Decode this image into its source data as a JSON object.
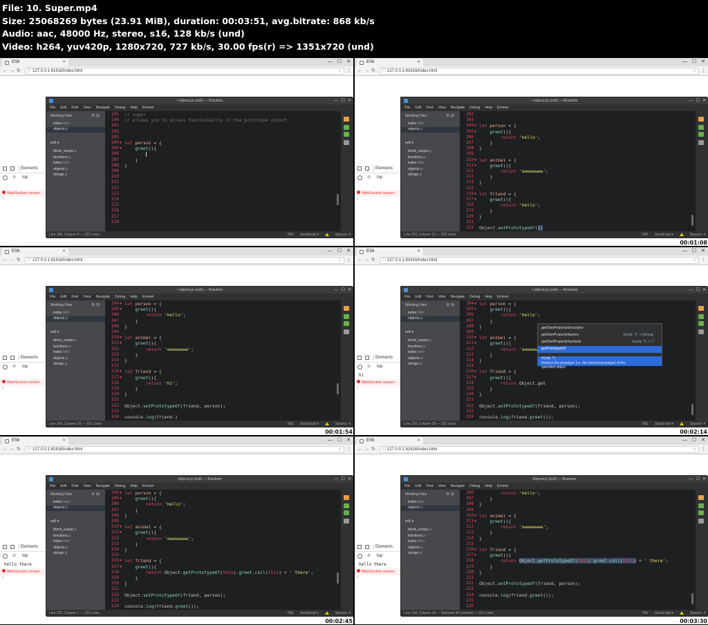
{
  "header": {
    "line1": "File: 10. Super.mp4",
    "line2": "Size: 25068269 bytes (23.91 MiB), duration: 00:03:51, avg.bitrate: 868 kb/s",
    "line3": "Audio: aac, 48000 Hz, stereo, s16, 128 kb/s (und)",
    "line4": "Video: h264, yuv420p, 1280x720, 727 kb/s, 30.00 fps(r) => 1351x720 (und)"
  },
  "browser": {
    "tab_title": "ES6",
    "url": "127.0.0.1:61616/index.html"
  },
  "devtools": {
    "elements_tab": "Elements",
    "context": "top",
    "error_text": "WebSocket connec"
  },
  "brackets": {
    "menu": [
      "File",
      "Edit",
      "Find",
      "View",
      "Navigate",
      "Debug",
      "Help",
      "Emmet"
    ],
    "working_files_label": "Working Files",
    "working_files": [
      {
        "name": "index",
        "ext": ".html"
      },
      {
        "name": "objects",
        "ext": ".js"
      }
    ],
    "project_label": "es6 ▾",
    "project_files": [
      {
        "name": "block_scope",
        "ext": ".js"
      },
      {
        "name": "functions",
        "ext": ".js"
      },
      {
        "name": "index",
        "ext": ".html"
      },
      {
        "name": "objects",
        "ext": ".js"
      },
      {
        "name": "strings",
        "ext": ".js"
      }
    ],
    "status_right": [
      "INS",
      "JavaScript ▾",
      "Spaces: 4"
    ]
  },
  "panels": [
    {
      "title": "• objects.js (es6) — Brackets",
      "timestamp": "",
      "status_left": "Line 206, Column 8 — 222 Lines",
      "log": "",
      "lines": [
        {
          "n": "195",
          "h": "<span class='cmt'>// super</span>"
        },
        {
          "n": "196",
          "h": "<span class='cmt'>// allows you to access functionality of the prototype object</span>"
        },
        {
          "n": "201",
          "h": ""
        },
        {
          "n": "202",
          "h": ""
        },
        {
          "n": "203",
          "h": ""
        },
        {
          "n": "204",
          "f": true,
          "h": "<span class='kw'>let</span> <span class='id'>person</span> = {"
        },
        {
          "n": "205",
          "f": true,
          "h": "    <span class='fn'>greet</span>(){"
        },
        {
          "n": "206",
          "h": "        <span class='cursor'></span>"
        },
        {
          "n": "207",
          "h": "    }"
        },
        {
          "n": "208",
          "h": "}"
        },
        {
          "n": "209",
          "h": ""
        },
        {
          "n": "210",
          "h": ""
        },
        {
          "n": "211",
          "h": ""
        },
        {
          "n": "212",
          "h": ""
        },
        {
          "n": "213",
          "h": ""
        },
        {
          "n": "214",
          "h": ""
        },
        {
          "n": "215",
          "h": ""
        },
        {
          "n": "216",
          "h": ""
        },
        {
          "n": "217",
          "h": ""
        },
        {
          "n": "218",
          "h": ""
        }
      ]
    },
    {
      "title": "• objects.js (es6) — Brackets",
      "timestamp": "00:01:08",
      "status_left": "Line 222, Column 23 — 228 Lines",
      "log": "",
      "lines": [
        {
          "n": "202",
          "h": ""
        },
        {
          "n": "203",
          "h": ""
        },
        {
          "n": "204",
          "f": true,
          "h": "<span class='kw'>let</span> <span class='id'>person</span> = {"
        },
        {
          "n": "205",
          "f": true,
          "h": "    <span class='fn'>greet</span>(){"
        },
        {
          "n": "206",
          "h": "        <span class='kw'>return</span> <span class='str'>'hello'</span>;"
        },
        {
          "n": "207",
          "h": "    }"
        },
        {
          "n": "208",
          "h": "}"
        },
        {
          "n": "209",
          "h": ""
        },
        {
          "n": "210",
          "f": true,
          "h": "<span class='kw'>let</span> <span class='id'>animal</span> = {"
        },
        {
          "n": "211",
          "f": true,
          "h": "    <span class='fn'>greet</span>(){"
        },
        {
          "n": "212",
          "h": "        <span class='kw'>return</span> <span class='str'>'owwwwwww'</span>;"
        },
        {
          "n": "213",
          "h": "    }"
        },
        {
          "n": "214",
          "h": "}"
        },
        {
          "n": "215",
          "h": ""
        },
        {
          "n": "216",
          "f": true,
          "h": "<span class='kw'>let</span> <span class='id'>friend</span> = {"
        },
        {
          "n": "217",
          "f": true,
          "h": "    <span class='fn'>greet</span>(){"
        },
        {
          "n": "218",
          "h": "        <span class='kw'>return</span> <span class='str'>'hello'</span>;"
        },
        {
          "n": "219",
          "h": "    }"
        },
        {
          "n": "220",
          "h": "}"
        },
        {
          "n": "221",
          "h": ""
        },
        {
          "n": "222",
          "h": "Object.<span class='fn'>setPrototypeOf</span>(<span class='hl-sel'>()</span>"
        }
      ]
    },
    {
      "title": "• objects.js (es6) — Brackets",
      "timestamp": "00:01:54",
      "status_left": "Line 224, Column 20 — 231 Lines",
      "log": "",
      "lines": [
        {
          "n": "204",
          "f": true,
          "h": "<span class='kw'>let</span> <span class='id'>person</span> = {"
        },
        {
          "n": "205",
          "f": true,
          "h": "    <span class='fn'>greet</span>(){"
        },
        {
          "n": "206",
          "h": "        <span class='kw'>return</span> <span class='str'>'hello'</span>;"
        },
        {
          "n": "207",
          "h": "    }"
        },
        {
          "n": "208",
          "h": "}"
        },
        {
          "n": "209",
          "h": ""
        },
        {
          "n": "210",
          "f": true,
          "h": "<span class='kw'>let</span> <span class='id'>animal</span> = {"
        },
        {
          "n": "211",
          "f": true,
          "h": "    <span class='fn'>greet</span>(){"
        },
        {
          "n": "212",
          "h": "        <span class='kw'>return</span> <span class='str'>'owwwwwww'</span>;"
        },
        {
          "n": "213",
          "h": "    }"
        },
        {
          "n": "214",
          "h": "}"
        },
        {
          "n": "215",
          "h": ""
        },
        {
          "n": "216",
          "f": true,
          "h": "<span class='kw'>let</span> <span class='id'>friend</span> = {"
        },
        {
          "n": "217",
          "f": true,
          "h": "    <span class='fn'>greet</span>(){"
        },
        {
          "n": "218",
          "h": "        <span class='kw'>return</span> <span class='str'>'hi'</span>;"
        },
        {
          "n": "219",
          "h": "    }"
        },
        {
          "n": "220",
          "h": "}"
        },
        {
          "n": "221",
          "h": ""
        },
        {
          "n": "222",
          "h": "Object.<span class='fn'>setPrototypeOf</span>(friend, person);"
        },
        {
          "n": "223",
          "h": ""
        },
        {
          "n": "224",
          "h": "console.<span class='fn'>log</span>(friend.)"
        }
      ]
    },
    {
      "title": "• objects.js (es6) — Brackets",
      "timestamp": "00:02:14",
      "status_left": "Line 218, Column 28 — 231 Lines",
      "log": "hi",
      "hint": {
        "items": [
          {
            "text": "getOwnPropertyDescriptor",
            "sig": ""
          },
          {
            "text": "getOwnPropertyNames",
            "sig": "fn(obj: ?) -> [string]"
          },
          {
            "text": "getOwnPropertySymbols",
            "sig": "fn(obj: ?) -> ?"
          },
          {
            "text": "getPrototypeOf",
            "sig": ""
          }
        ],
        "desc1": "fn(obj: ?)",
        "desc2": "Returns the prototype (i.e. the internal prototype) of the",
        "desc3": "specified object."
      },
      "lines": [
        {
          "n": "204",
          "f": true,
          "h": "<span class='kw'>let</span> <span class='id'>person</span> = {"
        },
        {
          "n": "205",
          "f": true,
          "h": "    <span class='fn'>greet</span>(){"
        },
        {
          "n": "206",
          "h": "        <span class='kw'>return</span> <span class='str'>'hello'</span>;"
        },
        {
          "n": "207",
          "h": "    }"
        },
        {
          "n": "208",
          "h": "}"
        },
        {
          "n": "209",
          "h": ""
        },
        {
          "n": "210",
          "f": true,
          "h": "<span class='kw'>let</span> <span class='id'>animal</span> = {"
        },
        {
          "n": "211",
          "f": true,
          "h": "    <span class='fn'>greet</span>(){"
        },
        {
          "n": "212",
          "h": "        <span class='kw'>return</span> <span class='str'>'owwwwwww'</span>;"
        },
        {
          "n": "213",
          "h": "    }"
        },
        {
          "n": "214",
          "h": "}"
        },
        {
          "n": "215",
          "h": ""
        },
        {
          "n": "216",
          "f": true,
          "h": "<span class='kw'>let</span> <span class='id'>friend</span> = {"
        },
        {
          "n": "217",
          "f": true,
          "h": "    <span class='fn'>greet</span>(){"
        },
        {
          "n": "218",
          "h": "        <span class='kw'>return</span> Object.get"
        },
        {
          "n": "219",
          "h": "    }"
        },
        {
          "n": "220",
          "h": "}"
        },
        {
          "n": "221",
          "h": ""
        },
        {
          "n": "222",
          "h": "Object.<span class='fn'>setPrototypeOf</span>(friend, person);"
        },
        {
          "n": "223",
          "h": ""
        },
        {
          "n": "224",
          "h": "console.<span class='fn'>log</span>(friend.<span class='fn'>greet</span>());"
        }
      ]
    },
    {
      "title": "objects.js (es6) — Brackets",
      "timestamp": "00:02:45",
      "status_left": "Line 225, Column 1 — 231 Lines",
      "log": "hello there",
      "lines": [
        {
          "n": "204",
          "f": true,
          "h": "<span class='kw'>let</span> <span class='id'>person</span> = {"
        },
        {
          "n": "205",
          "f": true,
          "h": "    <span class='fn'>greet</span>(){"
        },
        {
          "n": "206",
          "h": "        <span class='kw'>return</span> <span class='str'>'hello'</span>;"
        },
        {
          "n": "207",
          "h": "    }"
        },
        {
          "n": "208",
          "h": "}"
        },
        {
          "n": "209",
          "h": ""
        },
        {
          "n": "210",
          "f": true,
          "h": "<span class='kw'>let</span> <span class='id'>animal</span> = {"
        },
        {
          "n": "211",
          "f": true,
          "h": "    <span class='fn'>greet</span>(){"
        },
        {
          "n": "212",
          "h": "        <span class='kw'>return</span> <span class='str'>'owwwwwww'</span>;"
        },
        {
          "n": "213",
          "h": "    }"
        },
        {
          "n": "214",
          "h": "}"
        },
        {
          "n": "215",
          "h": ""
        },
        {
          "n": "216",
          "f": true,
          "h": "<span class='kw'>let</span> <span class='id'>friend</span> = {"
        },
        {
          "n": "217",
          "f": true,
          "h": "    <span class='fn'>greet</span>(){"
        },
        {
          "n": "218",
          "h": "        <span class='kw'>return</span> Object.<span class='fn'>getPrototypeOf</span>(<span class='kw'>this</span>).<span class='fn'>greet</span>.<span class='fn'>call</span>(<span class='kw'>this</span>) + <span class='str'>' there'</span>;"
        },
        {
          "n": "219",
          "h": "    }"
        },
        {
          "n": "220",
          "h": "}"
        },
        {
          "n": "221",
          "h": ""
        },
        {
          "n": "222",
          "h": "Object.<span class='fn'>setPrototypeOf</span>(friend, person);"
        },
        {
          "n": "223",
          "h": ""
        },
        {
          "n": "224",
          "h": "console.<span class='fn'>log</span>(friend.<span class='fn'>greet</span>());"
        }
      ]
    },
    {
      "title": "objects.js (es6) — Brackets",
      "timestamp": "00:03:30",
      "status_left": "Line 218, Column 16 — Selected 44 columns — 231 Lines",
      "log": "hello there",
      "lines": [
        {
          "n": "206",
          "h": "        <span class='kw'>return</span> <span class='str'>'hello'</span>;"
        },
        {
          "n": "207",
          "h": "    }"
        },
        {
          "n": "208",
          "h": "}"
        },
        {
          "n": "209",
          "h": ""
        },
        {
          "n": "210",
          "f": true,
          "h": "<span class='kw'>let</span> <span class='id'>animal</span> = {"
        },
        {
          "n": "211",
          "f": true,
          "h": "    <span class='fn'>greet</span>(){"
        },
        {
          "n": "212",
          "h": "        <span class='kw'>return</span> <span class='str'>'owwwwwww'</span>;"
        },
        {
          "n": "213",
          "h": "    }"
        },
        {
          "n": "214",
          "h": "}"
        },
        {
          "n": "215",
          "h": ""
        },
        {
          "n": "216",
          "f": true,
          "h": "<span class='kw'>let</span> <span class='id'>friend</span> = {"
        },
        {
          "n": "217",
          "f": true,
          "h": "    <span class='fn'>greet</span>(){"
        },
        {
          "n": "218",
          "h": "        <span class='kw'>return</span> <span class='hl-sel'>Object.<span class='fn'>getPrototypeOf</span>(<span class='kw'>this</span>).<span class='fn'>greet</span>.<span class='fn'>call</span>(<span class='kw'>this</span>)</span> + <span class='str'>' there'</span>;"
        },
        {
          "n": "219",
          "h": "    }"
        },
        {
          "n": "220",
          "h": "}"
        },
        {
          "n": "221",
          "h": ""
        },
        {
          "n": "222",
          "h": "Object.<span class='fn'>setPrototypeOf</span>(friend, person);"
        },
        {
          "n": "223",
          "h": ""
        },
        {
          "n": "224",
          "h": "console.<span class='fn'>log</span>(friend.<span class='fn'>greet</span>());"
        },
        {
          "n": "225",
          "h": ""
        },
        {
          "n": "226",
          "h": ""
        }
      ]
    }
  ]
}
